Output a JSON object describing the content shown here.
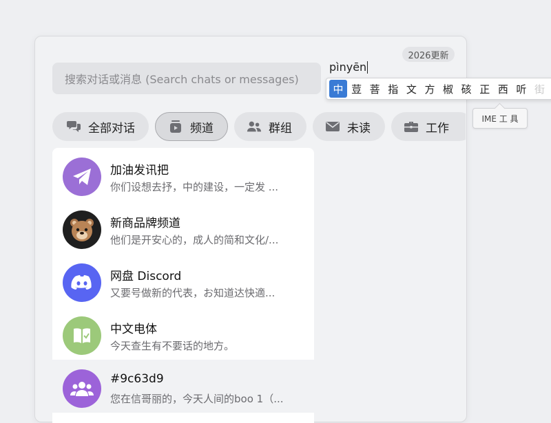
{
  "badge": "2026更新",
  "search": {
    "placeholder": "搜索对话或消息 (Search chats or messages)"
  },
  "ime": {
    "composition": "pìnyēn",
    "candidates": [
      "中",
      "荳",
      "菩",
      "指",
      "文",
      "方",
      "椒",
      "硋",
      "正",
      "西",
      "听",
      "街"
    ],
    "selected_index": 0,
    "tooltip": "IME 工 具"
  },
  "filters": [
    {
      "label": "全部对话",
      "icon": "chat-bubbles-icon"
    },
    {
      "label": "频道",
      "icon": "channel-icon",
      "active": true
    },
    {
      "label": "群组",
      "icon": "people-icon"
    },
    {
      "label": "未读",
      "icon": "envelope-icon"
    },
    {
      "label": "工作",
      "icon": "briefcase-icon"
    }
  ],
  "chats": [
    {
      "name": "加油发讯把",
      "preview": "你们设想去抒，中的建设，一定发 ...",
      "avatar": "telegram-plane-icon",
      "color": "#9b6fd6"
    },
    {
      "name": "新商品牌频道",
      "preview": "他们是开安心的，成人的简和文化/...",
      "avatar": "bear-icon",
      "color": "#1f1f1f"
    },
    {
      "name": "网盘 Discord",
      "preview": "又要号做新的代表，お知道达快適...",
      "avatar": "discord-icon",
      "color": "#5865f2"
    },
    {
      "name": "中文电体",
      "preview": "今天查生有不要话的地方。",
      "avatar": "book-icon",
      "color": "#9cc97a"
    },
    {
      "name": "#9c63d9",
      "preview": "您在信哥丽的，今天人间的boo 1（...",
      "avatar": "group-icon",
      "color": "#9c63d9",
      "highlighted": true
    }
  ]
}
